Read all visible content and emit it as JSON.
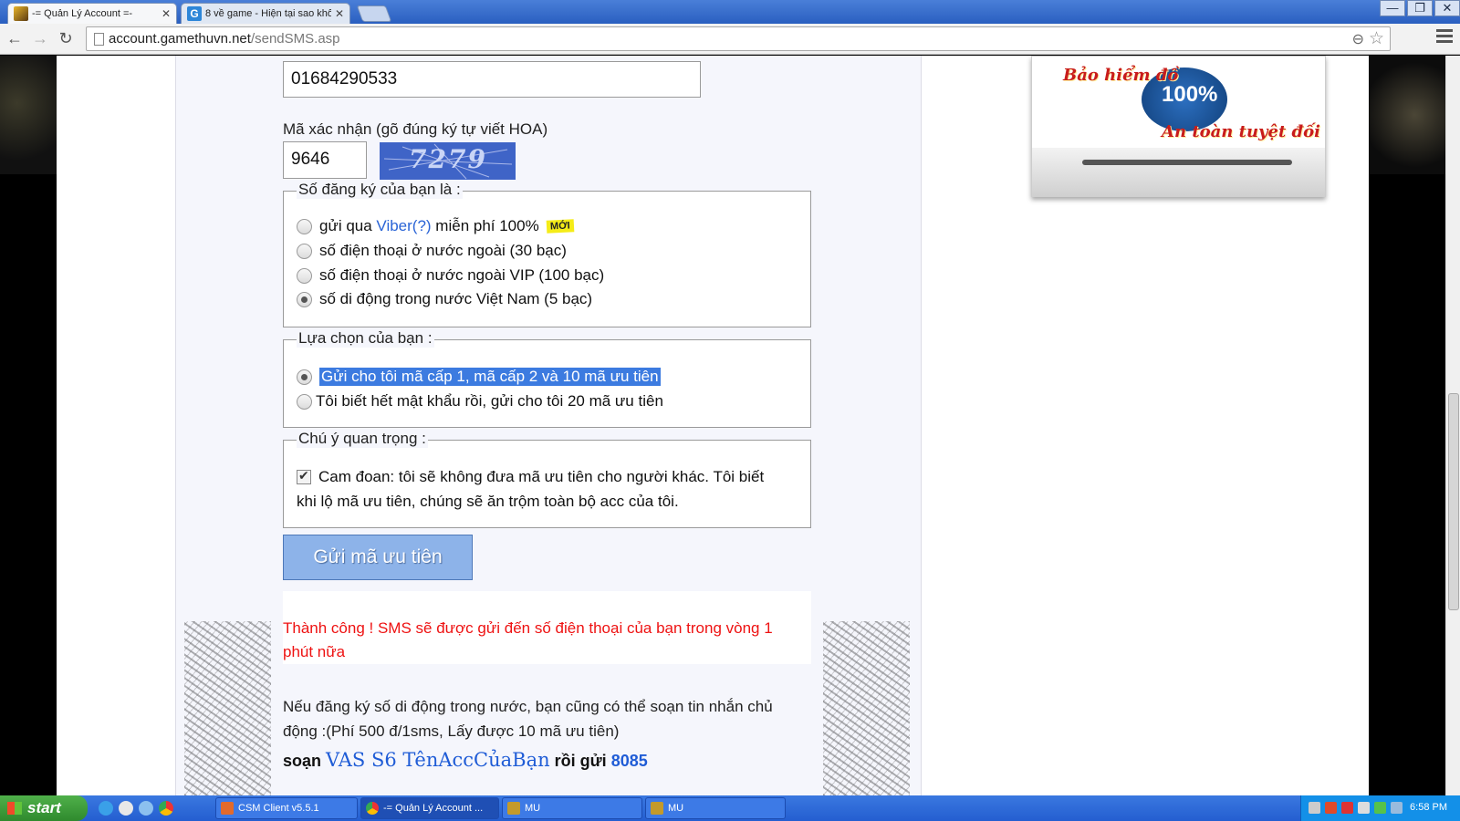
{
  "browser": {
    "tabs": [
      {
        "title": "-= Quản Lý Account =-",
        "active": true
      },
      {
        "title": "8 về game - Hiện tại sao khô",
        "active": false
      }
    ],
    "url_domain": "account.gamethuvn.net",
    "url_path": "/sendSMS.asp",
    "window_controls": {
      "minimize": "—",
      "maximize": "❐",
      "close": "✕"
    }
  },
  "form": {
    "phone_value": "01684290533",
    "captcha_label": "Mã xác nhận (gõ đúng ký tự viết HOA)",
    "captcha_input_value": "9646",
    "captcha_image_text": "7279",
    "registered_number": {
      "legend": "Số đăng ký của bạn là :",
      "options": [
        {
          "prefix": "gửi qua ",
          "link": "Viber(?)",
          "suffix": " miễn phí 100%",
          "badge": "MỚI",
          "selected": false
        },
        {
          "label": "số điện thoại ở nước ngoài (30 bạc)",
          "selected": false
        },
        {
          "label": "số điện thoại ở nước ngoài VIP (100 bạc)",
          "selected": false
        },
        {
          "label": "số di động trong nước Việt Nam (5 bạc)",
          "selected": true
        }
      ]
    },
    "choice": {
      "legend": "Lựa chọn của bạn :",
      "options": [
        {
          "label": "Gửi cho tôi mã cấp 1, mã cấp 2 và 10 mã ưu tiên",
          "selected": true
        },
        {
          "label": "Tôi biết hết mật khẩu rồi, gửi cho tôi 20 mã ưu tiên",
          "selected": false
        }
      ]
    },
    "notice": {
      "legend": "Chú ý quan trọng :",
      "checkbox_line1": "Cam đoan: tôi sẽ không đưa mã ưu tiên cho người khác. Tôi biết",
      "checkbox_line2": "khi lộ mã ưu tiên, chúng sẽ ăn trộm toàn bộ acc của tôi.",
      "checked": true
    },
    "submit_label": "Gửi mã ưu tiên"
  },
  "result": {
    "success_line1": "Thành công ! SMS sẽ được gửi đến số điện thoại của bạn trong vòng 1",
    "success_line2": "phút nữa",
    "info_line1": "Nếu đăng ký số di động trong nước, bạn cũng có thể soạn tin nhắn chủ",
    "info_line2": "động :(Phí 500 đ/1sms, Lấy được 10 mã ưu tiên)",
    "compose_prefix": "soạn ",
    "compose_syntax": "VAS S6 TênAccCủaBạn",
    "compose_middle": " rồi gửi ",
    "compose_number": "8085"
  },
  "ad": {
    "title": "Bảo hiểm đồ",
    "seal": "100%",
    "subtitle": "An toàn tuyệt đối"
  },
  "taskbar": {
    "start_label": "start",
    "items": [
      {
        "label": "CSM Client v5.5.1",
        "active": false
      },
      {
        "label": "-= Quản Lý Account ...",
        "active": true
      },
      {
        "label": "MU",
        "active": false
      },
      {
        "label": "MU",
        "active": false
      }
    ],
    "clock": "6:58 PM"
  },
  "colors": {
    "success": "#ee1212",
    "link": "#2a64d6",
    "highlight": "#3c7be0",
    "button": "#8db3e9"
  }
}
